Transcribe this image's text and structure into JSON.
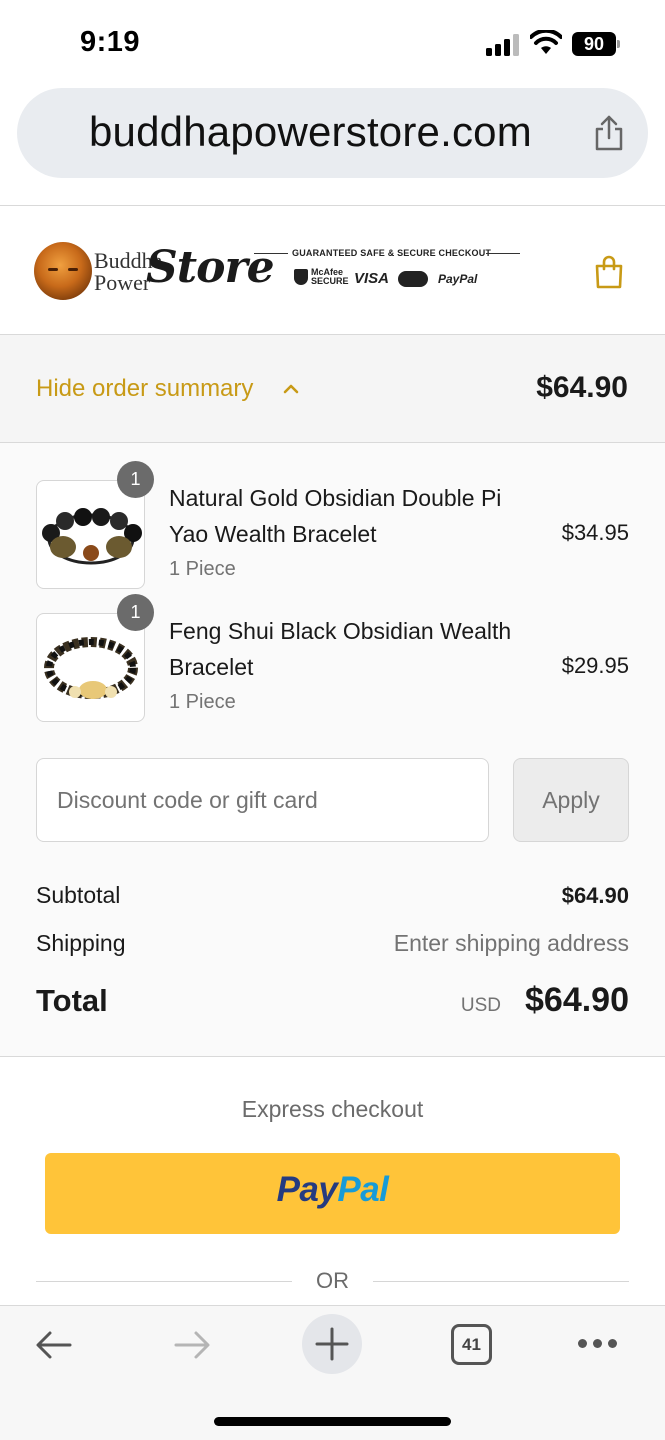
{
  "status_bar": {
    "time": "9:19",
    "battery": "90"
  },
  "browser": {
    "url": "buddhapowerstore.com",
    "share_icon": "share-icon"
  },
  "header": {
    "logo": {
      "word1": "Buddha",
      "word2": "Power",
      "word3": "Store"
    },
    "secure_title": "GUARANTEED SAFE & SECURE CHECKOUT",
    "badges": {
      "mcafee_line1": "McAfee",
      "mcafee_line2": "SECURE",
      "visa": "VISA",
      "paypal": "PayPal"
    },
    "cart_icon": "shopping-bag-icon"
  },
  "summary_toggle": {
    "label": "Hide order summary",
    "total": "$64.90",
    "accent_color": "#c89a16"
  },
  "products": [
    {
      "quantity": "1",
      "name": "Natural Gold Obsidian Double Pi Yao Wealth Bracelet",
      "variant": "1 Piece",
      "price": "$34.95"
    },
    {
      "quantity": "1",
      "name": "Feng Shui Black Obsidian Wealth Bracelet",
      "variant": "1 Piece",
      "price": "$29.95"
    }
  ],
  "discount": {
    "placeholder": "Discount code or gift card",
    "apply_label": "Apply"
  },
  "totals": {
    "subtotal_label": "Subtotal",
    "subtotal_value": "$64.90",
    "shipping_label": "Shipping",
    "shipping_value": "Enter shipping address",
    "total_label": "Total",
    "currency": "USD",
    "total_value": "$64.90"
  },
  "express": {
    "label": "Express checkout",
    "paypal_pay": "Pay",
    "paypal_pal": "Pal",
    "or_label": "OR",
    "paypal_color": "#ffc439"
  },
  "toolbar": {
    "tab_count": "41"
  }
}
